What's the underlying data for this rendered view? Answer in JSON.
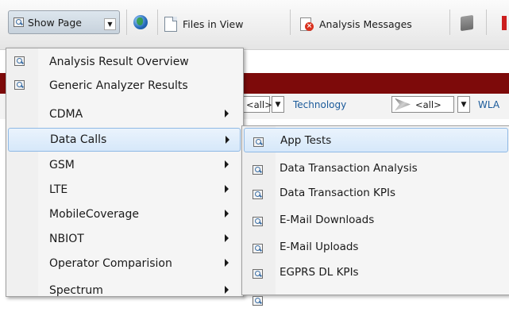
{
  "toolbar": {
    "show_page": "Show Page",
    "files_in_view": "Files in View",
    "analysis_messages": "Analysis Messages"
  },
  "filters": {
    "all_1": "<all>",
    "technology": "Technology",
    "all_2": "<all>",
    "wla": "WLA"
  },
  "menu": {
    "items": [
      {
        "label": "Analysis Result Overview",
        "icon": "magnifier-page-icon",
        "submenu": false
      },
      {
        "label": "Generic Analyzer Results",
        "icon": "magnifier-page-icon",
        "submenu": false
      },
      {
        "label": "CDMA",
        "submenu": true
      },
      {
        "label": "Data Calls",
        "submenu": true,
        "highlighted": true
      },
      {
        "label": "GSM",
        "submenu": true
      },
      {
        "label": "LTE",
        "submenu": true
      },
      {
        "label": "MobileCoverage",
        "submenu": true
      },
      {
        "label": "NBIOT",
        "submenu": true
      },
      {
        "label": "Operator Comparision",
        "submenu": true
      },
      {
        "label": "Spectrum",
        "submenu": true
      }
    ]
  },
  "submenu": {
    "items": [
      {
        "label": "App Tests",
        "highlighted": true
      },
      {
        "label": "Data Transaction Analysis"
      },
      {
        "label": "Data Transaction KPIs"
      },
      {
        "label": "E-Mail Downloads"
      },
      {
        "label": "E-Mail Uploads"
      },
      {
        "label": "EGPRS DL KPIs"
      },
      {
        "label": ""
      }
    ]
  },
  "colors": {
    "accent_bar": "#7d0a0a",
    "highlight": "#d6e8fa",
    "link": "#1a5a9a"
  }
}
